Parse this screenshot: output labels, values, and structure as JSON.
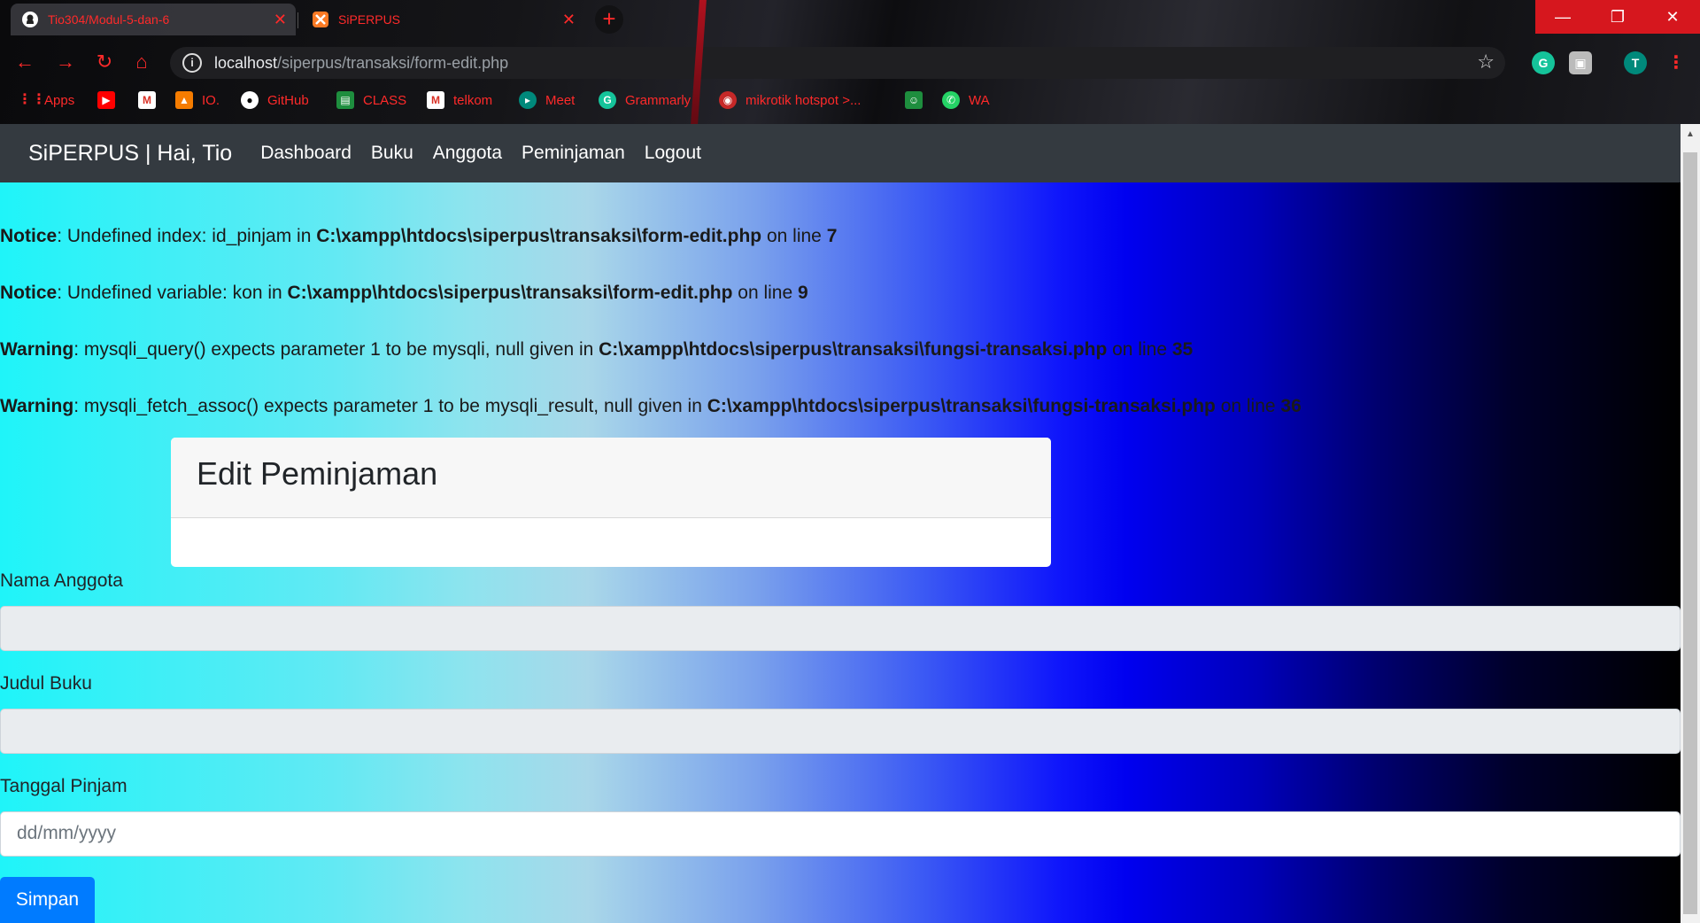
{
  "browser": {
    "tabs": [
      {
        "title": "Tio304/Modul-5-dan-6",
        "icon": "github-icon"
      },
      {
        "title": "SiPERPUS",
        "icon": "xampp-icon"
      }
    ],
    "url_host": "localhost",
    "url_path": "/siperpus/transaksi/form-edit.php",
    "profile_initial": "T",
    "bookmarks": [
      {
        "label": "Apps",
        "icon": "apps-grid-icon"
      },
      {
        "label": "",
        "icon": "youtube-icon"
      },
      {
        "label": "",
        "icon": "gmail-icon"
      },
      {
        "label": "IO.",
        "icon": "io-icon"
      },
      {
        "label": "GitHub",
        "icon": "github-icon"
      },
      {
        "label": "CLASS",
        "icon": "classroom-icon"
      },
      {
        "label": "telkom",
        "icon": "gmail-icon"
      },
      {
        "label": "Meet",
        "icon": "meet-icon"
      },
      {
        "label": "Grammarly",
        "icon": "grammarly-icon"
      },
      {
        "label": "mikrotik hotspot >...",
        "icon": "mikrotik-icon"
      },
      {
        "label": "",
        "icon": "contacts-icon"
      },
      {
        "label": "WA",
        "icon": "whatsapp-icon"
      }
    ],
    "accent": "#ff2a2a"
  },
  "app": {
    "brand": "SiPERPUS | Hai, Tio",
    "nav": [
      "Dashboard",
      "Buku",
      "Anggota",
      "Peminjaman",
      "Logout"
    ]
  },
  "messages": [
    {
      "type": "Notice",
      "text": ": Undefined index: id_pinjam in ",
      "file": "C:\\xampp\\htdocs\\siperpus\\transaksi\\form-edit.php",
      "on": " on line ",
      "line": "7"
    },
    {
      "type": "Notice",
      "text": ": Undefined variable: kon in ",
      "file": "C:\\xampp\\htdocs\\siperpus\\transaksi\\form-edit.php",
      "on": " on line ",
      "line": "9"
    },
    {
      "type": "Warning",
      "text": ": mysqli_query() expects parameter 1 to be mysqli, null given in ",
      "file": "C:\\xampp\\htdocs\\siperpus\\transaksi\\fungsi-transaksi.php",
      "on": " on line ",
      "line": "35"
    },
    {
      "type": "Warning",
      "text": ": mysqli_fetch_assoc() expects parameter 1 to be mysqli_result, null given in ",
      "file": "C:\\xampp\\htdocs\\siperpus\\transaksi\\fungsi-transaksi.php",
      "on": " on line ",
      "line": "36"
    }
  ],
  "form": {
    "title": "Edit Peminjaman",
    "fields": [
      {
        "label": "Nama Anggota",
        "value": ""
      },
      {
        "label": "Judul Buku",
        "value": ""
      },
      {
        "label": "Tanggal Pinjam",
        "placeholder": "dd/mm/yyyy"
      }
    ],
    "submit": "Simpan"
  }
}
